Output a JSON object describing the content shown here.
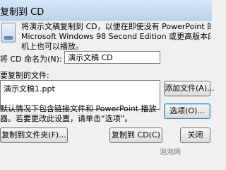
{
  "window": {
    "title": "复制到 CD"
  },
  "intro": {
    "line1": "将演示文稿复制到 CD，以便在即使没有 PowerPoint 的",
    "line2": "Microsoft Windows 98 Second Edition 或更高版本的",
    "line3": "机上也可以播放。"
  },
  "cd_name": {
    "label": "将 CD 命名为(N):",
    "value": "演示文稿 CD"
  },
  "files": {
    "label": "要复制的文件:",
    "items": [
      "演示文稿1.ppt"
    ],
    "add_button": "添加文件(A)..."
  },
  "note": {
    "line1": "默认情况下包含链接文件和 PowerPoint 播放",
    "line2": "器。若要更改此设置，请单击“选项”。"
  },
  "options_button": "选项(O)...",
  "footer": {
    "copy_to_folder_button": "复制到文件夹(F)...",
    "copy_to_cd_button": "复制到 CD(C)",
    "close_button": "关闭"
  },
  "watermark": "泡泡网"
}
